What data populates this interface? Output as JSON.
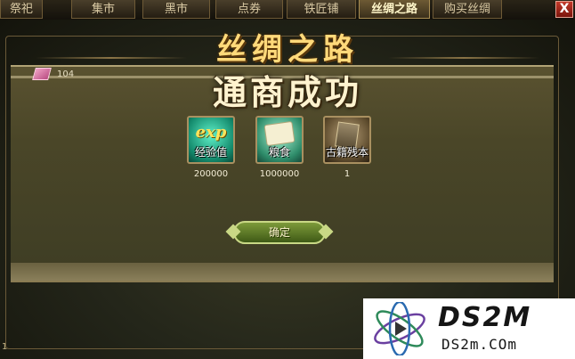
{
  "tabs": [
    {
      "label": "祭祀",
      "active": false
    },
    {
      "label": "集市",
      "active": false
    },
    {
      "label": "黑市",
      "active": false
    },
    {
      "label": "点券",
      "active": false
    },
    {
      "label": "铁匠铺",
      "active": false
    },
    {
      "label": "丝绸之路",
      "active": true
    },
    {
      "label": "购买丝绸",
      "active": false
    }
  ],
  "close_label": "X",
  "page_title": "丝绸之路",
  "currency": {
    "icon": "silk-ticket-icon",
    "value": "104"
  },
  "result_title": "通商成功",
  "rewards": [
    {
      "icon": "exp-icon",
      "icon_text": "exp",
      "label": "经验值",
      "amount": "200000"
    },
    {
      "icon": "grain-icon",
      "label": "粮食",
      "amount": "1000000"
    },
    {
      "icon": "ancient-book-icon",
      "label": "古籍残本",
      "amount": "1"
    }
  ],
  "confirm_label": "确定",
  "page_counter": "1",
  "watermark": {
    "title": "DS2M",
    "subtitle": "DS2m.COm"
  },
  "colors": {
    "title_gold": "#ffd97a",
    "button_green": "#5f7d26",
    "close_red": "#c43a2a"
  }
}
